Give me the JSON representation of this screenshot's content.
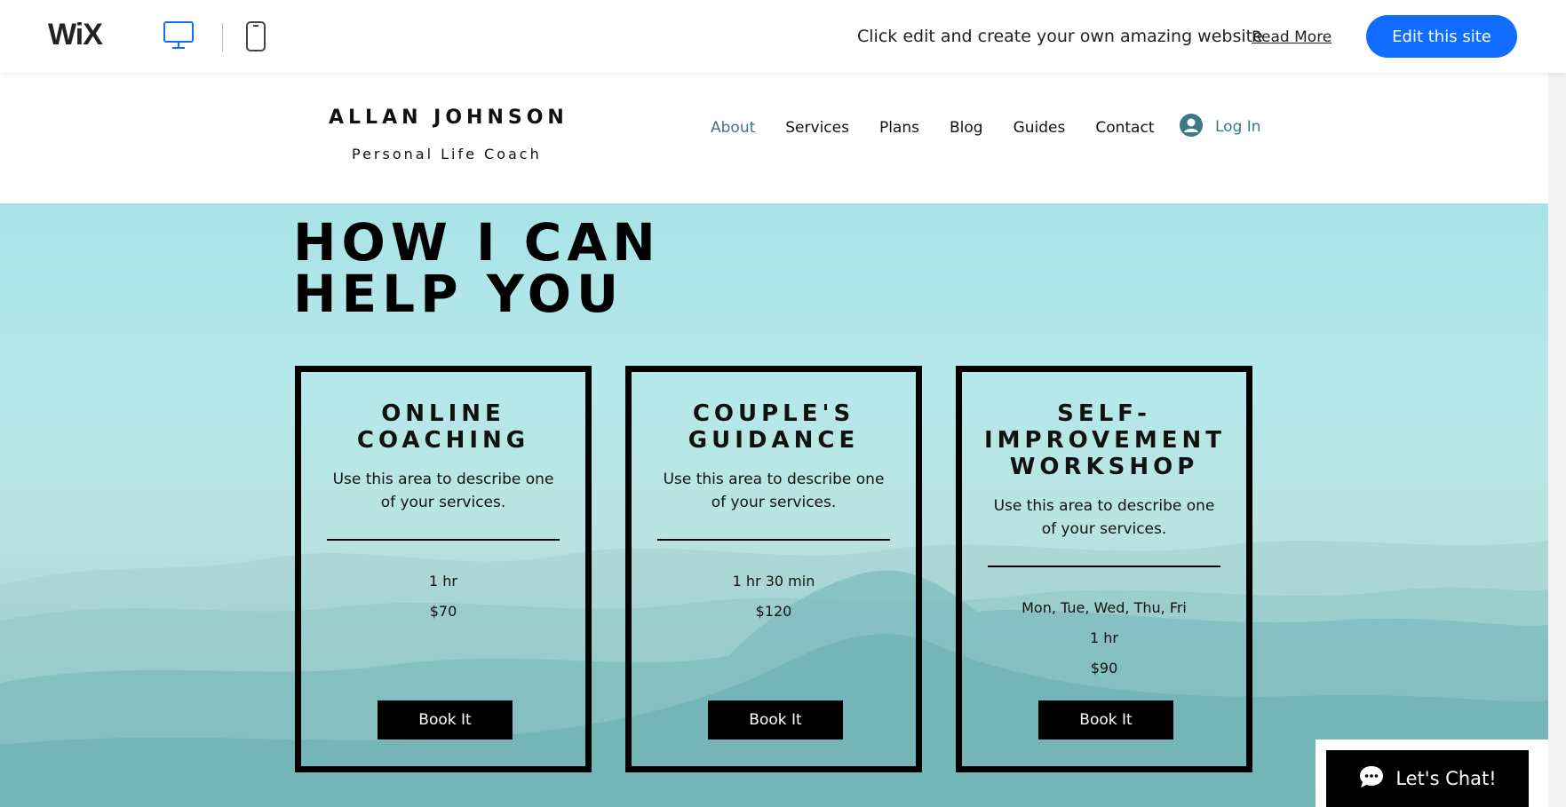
{
  "wix_bar": {
    "logo": "WiX",
    "message": "Click edit and create your own amazing website",
    "read_more": "Read More",
    "edit_button": "Edit this site"
  },
  "site": {
    "title": "ALLAN JOHNSON",
    "subtitle": "Personal Life Coach",
    "nav": [
      "About",
      "Services",
      "Plans",
      "Blog",
      "Guides",
      "Contact"
    ],
    "active_nav": "About",
    "login": "Log In"
  },
  "hero": {
    "title_line1": "HOW I CAN",
    "title_line2": "HELP YOU"
  },
  "cards": [
    {
      "title": "ONLINE COACHING",
      "description": "Use this area to describe one of your services.",
      "details": [
        "1 hr",
        "$70"
      ],
      "button": "Book It"
    },
    {
      "title": "COUPLE'S GUIDANCE",
      "description": "Use this area to describe one of your services.",
      "details": [
        "1 hr 30 min",
        "$120"
      ],
      "button": "Book It"
    },
    {
      "title": "SELF-IMPROVEMENT WORKSHOP",
      "description": "Use this area to describe one of your services.",
      "details": [
        "Mon, Tue, Wed, Thu, Fri",
        "1 hr",
        "$90"
      ],
      "button": "Book It"
    }
  ],
  "chat": {
    "label": "Let's Chat!"
  },
  "colors": {
    "accent": "#116dff",
    "nav_active": "#3b7a84",
    "hero_sky": "#b6e8ea"
  },
  "icons": [
    "desktop-icon",
    "mobile-icon",
    "user-avatar-icon",
    "chat-bubble-icon"
  ]
}
